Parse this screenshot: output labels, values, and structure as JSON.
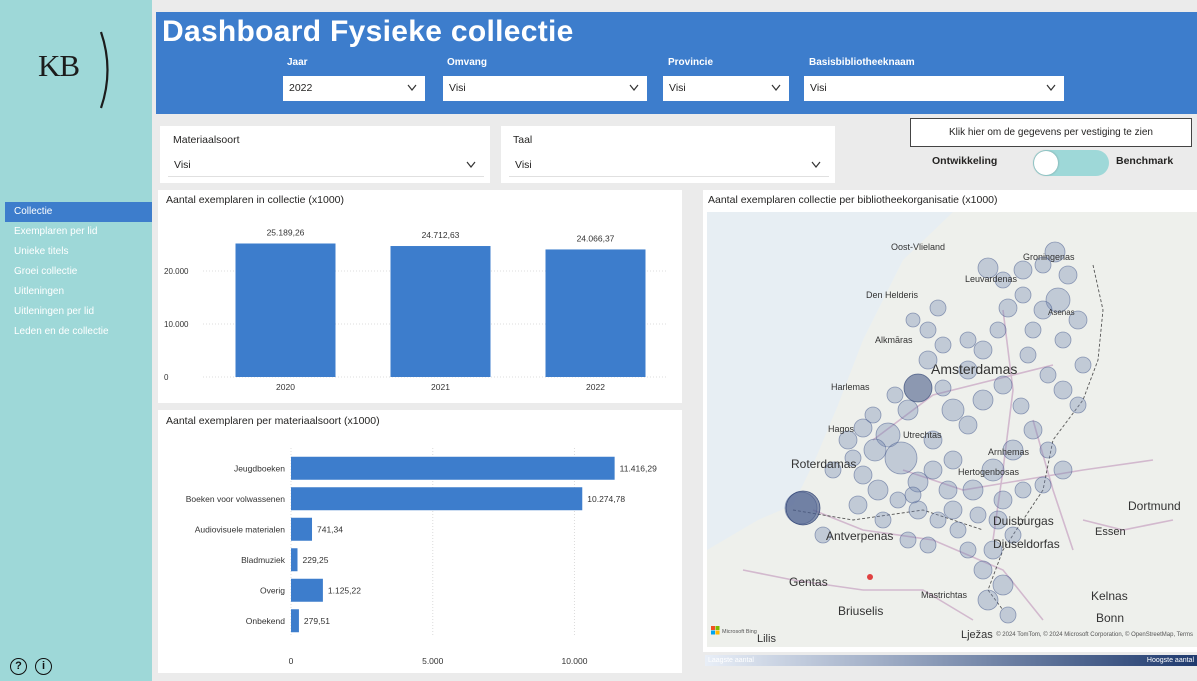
{
  "header": {
    "title": "Dashboard Fysieke collectie",
    "logo_text": "KB"
  },
  "nav": [
    {
      "label": "Collectie",
      "active": true
    },
    {
      "label": "Exemplaren per lid"
    },
    {
      "label": "Unieke titels"
    },
    {
      "label": "Groei collectie"
    },
    {
      "label": "Uitleningen"
    },
    {
      "label": "Uitleningen per lid"
    },
    {
      "label": "Leden en de collectie"
    }
  ],
  "slicers": {
    "jaar": {
      "label": "Jaar",
      "value": "2022"
    },
    "omvang": {
      "label": "Omvang",
      "value": "Visi"
    },
    "provincie": {
      "label": "Provincie",
      "value": "Visi"
    },
    "basisbibliotheek": {
      "label": "Basisbibliotheeknaam",
      "value": "Visi"
    },
    "materiaalsoort": {
      "label": "Materiaalsoort",
      "value": "Visi"
    },
    "taal": {
      "label": "Taal",
      "value": "Visi"
    }
  },
  "vestiging_button": "Klik hier om de gegevens per vestiging te zien",
  "toggle": {
    "left": "Ontwikkeling",
    "right": "Benchmark"
  },
  "icons": {
    "help": "help-icon",
    "info": "info-icon"
  },
  "colors": {
    "accent": "#3d7dcc",
    "sidebar": "#9ed8d8"
  },
  "chart_data": [
    {
      "type": "bar",
      "title": "Aantal exemplaren in collectie (x1000)",
      "categories": [
        "2020",
        "2021",
        "2022"
      ],
      "values": [
        25189.26,
        24712.63,
        24066.37
      ],
      "value_labels": [
        "25.189,26",
        "24.712,63",
        "24.066,37"
      ],
      "yticks": [
        "0",
        "10.000",
        "20.000"
      ],
      "ylim": [
        0,
        30000
      ],
      "grid": true
    },
    {
      "type": "bar",
      "orientation": "horizontal",
      "title": "Aantal exemplaren per materiaalsoort (x1000)",
      "categories": [
        "Jeugdboeken",
        "Boeken voor volwassenen",
        "Audiovisuele materialen",
        "Bladmuziek",
        "Overig",
        "Onbekend"
      ],
      "values": [
        11416.29,
        10274.78,
        741.34,
        229.25,
        1125.22,
        279.51
      ],
      "value_labels": [
        "11.416,29",
        "10.274,78",
        "741,34",
        "229,25",
        "1.125,22",
        "279,51"
      ],
      "xticks": [
        "0",
        "5.000",
        "10.000"
      ],
      "xlim": [
        0,
        11500
      ],
      "grid": true
    }
  ],
  "map": {
    "title": "Aantal exemplaren collectie per bibliotheekorganisatie (x1000)",
    "places": [
      "Oost-Vlieland",
      "Groningenas",
      "Leuvardenas",
      "Den Helderis",
      "Asenas",
      "Alkmāras",
      "Amsterdamas",
      "Harlemas",
      "Hagos",
      "Utrechtas",
      "Arnhemas",
      "Roterdamas",
      "Hertogenbosas",
      "Duisburgas",
      "Essen",
      "Dortmund",
      "Antverpenas",
      "Diuseldorfas",
      "Gentas",
      "Mastrichtas",
      "Kelnas",
      "Briuselis",
      "Bonn",
      "Lježas",
      "Lilis"
    ],
    "credits": "© 2024 TomTom, © 2024 Microsoft Corporation, © OpenStreetMap, Terms",
    "ms_logo": "Microsoft Bing",
    "legend_low": "Laagste aantal",
    "legend_high": "Hoogste aantal"
  }
}
